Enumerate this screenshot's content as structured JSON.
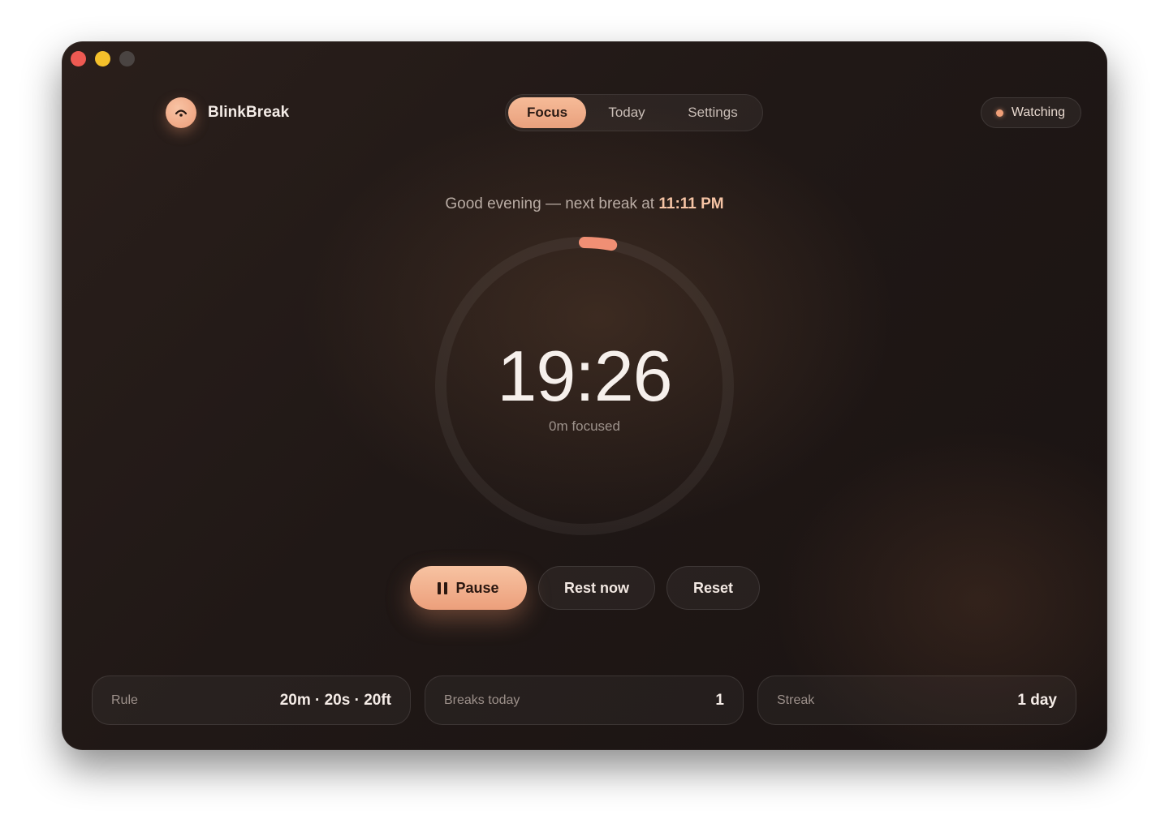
{
  "window": {
    "traffic_lights": [
      "close",
      "minimize",
      "zoom"
    ]
  },
  "brand": {
    "name": "BlinkBreak",
    "icon": "eye-arc-icon"
  },
  "tabs": [
    {
      "label": "Focus",
      "active": true
    },
    {
      "label": "Today",
      "active": false
    },
    {
      "label": "Settings",
      "active": false
    }
  ],
  "status": {
    "label": "Watching",
    "color": "#f09f78"
  },
  "greeting": {
    "prefix": "Good evening — next break at ",
    "time": "11:11 PM"
  },
  "timer": {
    "remaining": "19:26",
    "focused": "0m focused",
    "progress_fraction": 0.03,
    "ring_color": "#f08f74"
  },
  "controls": {
    "pause_label": "Pause",
    "rest_label": "Rest now",
    "reset_label": "Reset"
  },
  "stats": [
    {
      "label": "Rule",
      "value": "20m · 20s · 20ft"
    },
    {
      "label": "Breaks today",
      "value": "1"
    },
    {
      "label": "Streak",
      "value": "1 day"
    }
  ],
  "colors": {
    "accent": "#f0a27e",
    "background": "#201816"
  }
}
